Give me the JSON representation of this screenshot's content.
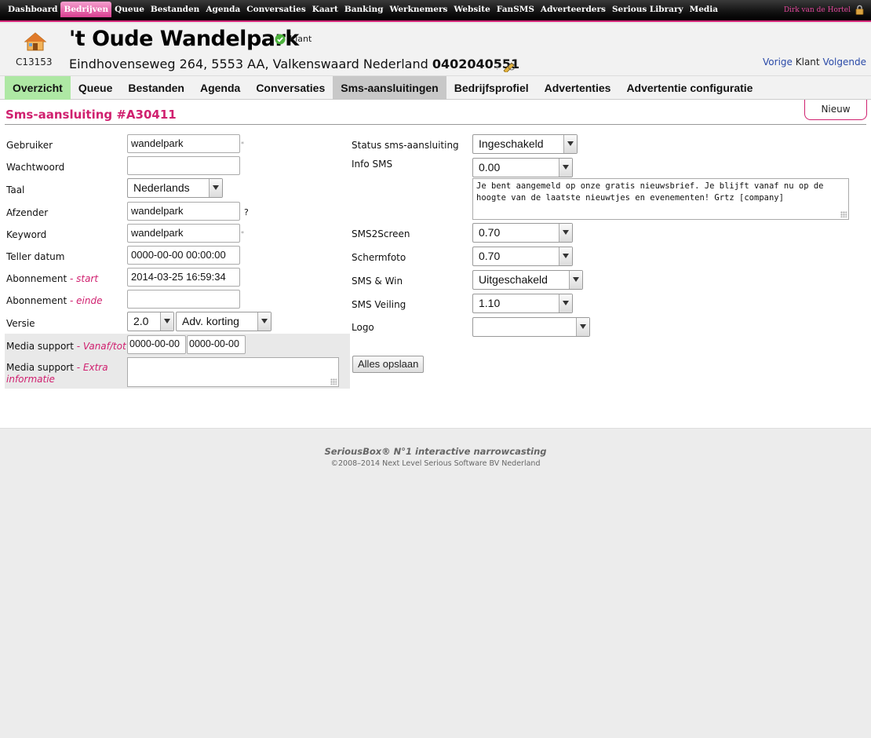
{
  "topnav": {
    "items": [
      "Dashboard",
      "Bedrijven",
      "Queue",
      "Bestanden",
      "Agenda",
      "Conversaties",
      "Kaart",
      "Banking",
      "Werknemers",
      "Website",
      "FanSMS",
      "Adverteerders",
      "Serious Library",
      "Media"
    ],
    "active_index": 1,
    "user": "Dirk van de Hortel",
    "accent": "#d6287b"
  },
  "header": {
    "code": "C13153",
    "company": "'t Oude Wandelpark",
    "badge": "Klant",
    "address": "Eindhovenseweg 264, 5553 AA, Valkenswaard Nederland",
    "phone": "0402040551",
    "prev": "Vorige",
    "klant": "Klant",
    "next": "Volgende"
  },
  "tabs": [
    "Overzicht",
    "Queue",
    "Bestanden",
    "Agenda",
    "Conversaties",
    "Sms-aansluitingen",
    "Bedrijfsprofiel",
    "Advertenties",
    "Advertentie configuratie"
  ],
  "active_tab": 5,
  "section": {
    "title": "Sms-aansluiting #A30411",
    "new_button": "Nieuw"
  },
  "form_left": {
    "gebruiker": {
      "label": "Gebruiker",
      "value": "wandelpark"
    },
    "wachtwoord": {
      "label": "Wachtwoord",
      "value": ""
    },
    "taal": {
      "label": "Taal",
      "value": "Nederlands"
    },
    "afzender": {
      "label": "Afzender",
      "value": "wandelpark",
      "hint": "?"
    },
    "keyword": {
      "label": "Keyword",
      "value": "wandelpark"
    },
    "teller": {
      "label": "Teller datum",
      "value": "0000-00-00 00:00:00"
    },
    "abo_start": {
      "label": "Abonnement",
      "sep": " - ",
      "em": "start",
      "value": "2014-03-25 16:59:34"
    },
    "abo_einde": {
      "label": "Abonnement",
      "sep": " - ",
      "em": "einde",
      "value": ""
    },
    "versie": {
      "label": "Versie",
      "value": "2.0",
      "value2": "Adv. korting"
    },
    "media_support": {
      "label": "Media support",
      "sep": " - ",
      "em": "Vanaf/tot",
      "from": "0000-00-00",
      "to": "0000-00-00"
    },
    "media_extra": {
      "label": "Media support",
      "sep": " - ",
      "em": "Extra informatie",
      "value": ""
    }
  },
  "form_right": {
    "status": {
      "label": "Status sms-aansluiting",
      "value": "Ingeschakeld"
    },
    "info_sms": {
      "label": "Info SMS",
      "value": "0.00",
      "message": "Je bent aangemeld op onze gratis nieuwsbrief. Je blijft vanaf nu op de hoogte van de laatste nieuwtjes en evenementen! Grtz [company]"
    },
    "sms2screen": {
      "label": "SMS2Screen",
      "value": "0.70"
    },
    "schermfoto": {
      "label": "Schermfoto",
      "value": "0.70"
    },
    "sms_win": {
      "label": "SMS & Win",
      "value": "Uitgeschakeld"
    },
    "sms_veiling": {
      "label": "SMS Veiling",
      "value": "1.10"
    },
    "logo": {
      "label": "Logo",
      "value": ""
    },
    "save_button": "Alles opslaan"
  },
  "footer": {
    "line1": "SeriousBox® N°1 interactive narrowcasting",
    "line2": "©2008–2014 Next Level Serious Software BV Nederland"
  }
}
